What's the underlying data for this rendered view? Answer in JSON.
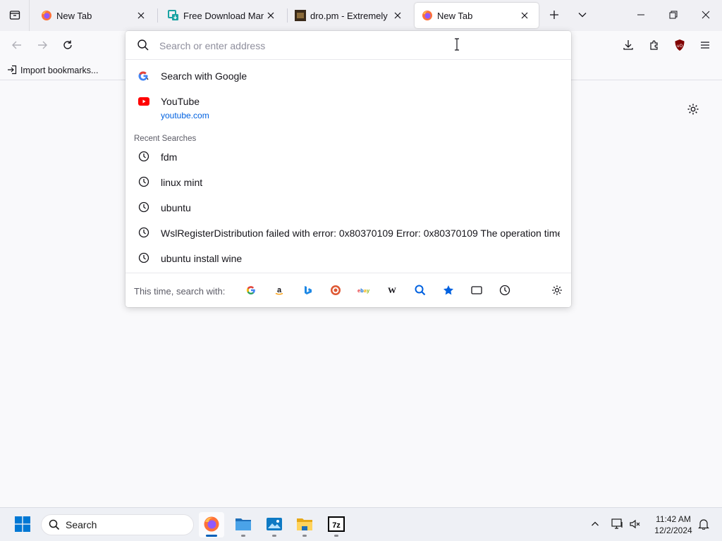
{
  "tabs": [
    {
      "title": "New Tab",
      "favicon": "firefox-icon",
      "active": false
    },
    {
      "title": "Free Download Manager",
      "favicon": "fdm-icon",
      "active": false
    },
    {
      "title": "dro.pm - Extremely Short",
      "favicon": "dro-pm-icon",
      "active": false
    },
    {
      "title": "New Tab",
      "favicon": "firefox-icon",
      "active": true
    }
  ],
  "bookmarks": {
    "import_label": "Import bookmarks..."
  },
  "urlbar": {
    "placeholder": "Search or enter address",
    "value": "",
    "search_with_google": "Search with Google",
    "youtube": {
      "title": "YouTube",
      "url": "youtube.com"
    },
    "recent_label": "Recent Searches",
    "recent": [
      "fdm",
      "linux mint",
      "ubuntu",
      "WslRegisterDistribution failed with error: 0x80370109 Error: 0x80370109 The operation timed out",
      "ubuntu install wine"
    ],
    "search_with_label": "This time, search with:",
    "engines": [
      "google-icon",
      "amazon-icon",
      "bing-icon",
      "duckduckgo-icon",
      "ebay-icon",
      "wikipedia-icon",
      "search-icon",
      "bookmarks-star-icon",
      "tabs-icon",
      "history-icon"
    ]
  },
  "taskbar": {
    "search_label": "Search",
    "apps": [
      "firefox-icon",
      "file-explorer-icon",
      "photos-icon",
      "folder-icon",
      "7zip-icon"
    ]
  },
  "clock": {
    "time": "11:42 AM",
    "date": "12/2/2024"
  },
  "colors": {
    "accent": "#0061e0",
    "firefox_orange": "#ff7139",
    "ublock_red": "#800000",
    "win_blue": "#0078d4"
  }
}
